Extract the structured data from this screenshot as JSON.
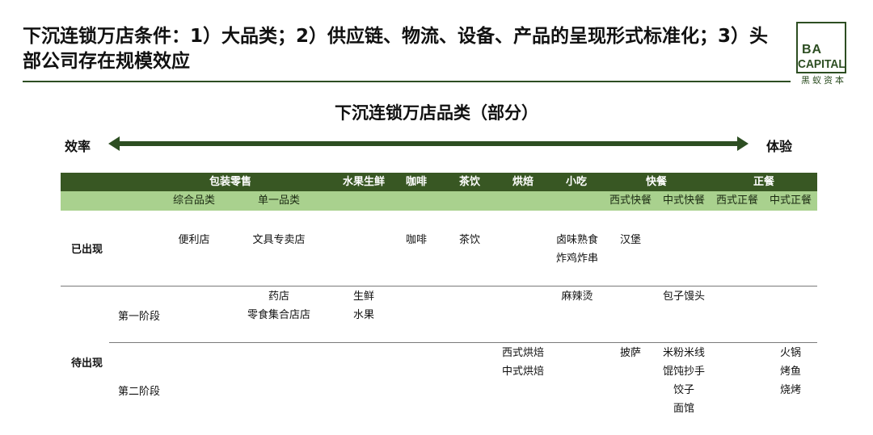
{
  "header": {
    "title": "下沉连锁万店条件：1）大品类；2）供应链、物流、设备、产品的呈现形式标准化；3）头部公司存在规模效应",
    "logo": {
      "line1": "BA",
      "line2": "CAPITAL",
      "line3": "黑蚁资本"
    }
  },
  "chart": {
    "title": "下沉连锁万店品类（部分）",
    "axis_left": "效率",
    "axis_right": "体验",
    "colors": {
      "dark_green": "#385723",
      "light_green": "#a9d18e",
      "arrow": "#2d4e22"
    }
  },
  "table": {
    "groups": [
      "包装零售",
      "水果生鲜",
      "咖啡",
      "茶饮",
      "烘焙",
      "小吃",
      "快餐",
      "正餐"
    ],
    "subgroups": [
      "综合品类",
      "单一品类",
      "西式快餐",
      "中式快餐",
      "西式正餐",
      "中式正餐"
    ],
    "rows": {
      "appeared": "已出现",
      "pending": "待出现",
      "stage1": "第一阶段",
      "stage2": "第二阶段"
    },
    "appeared": {
      "convenience": "便利店",
      "stationery": "文具专卖店",
      "coffee": "咖啡",
      "tea": "茶饮",
      "snack": [
        "卤味熟食",
        "炸鸡炸串"
      ],
      "fast_western": "汉堡"
    },
    "stage1": {
      "single": [
        "药店",
        "零食集合店店"
      ],
      "fruit": [
        "生鲜",
        "水果"
      ],
      "snack": "麻辣烫",
      "fast_chinese": "包子馒头"
    },
    "stage2": {
      "bakery": [
        "西式烘焙",
        "中式烘焙"
      ],
      "fast_western": "披萨",
      "fast_chinese": [
        "米粉米线",
        "馄饨抄手",
        "饺子",
        "面馆"
      ],
      "dinner_chinese": [
        "火锅",
        "烤鱼",
        "烧烤"
      ]
    }
  }
}
